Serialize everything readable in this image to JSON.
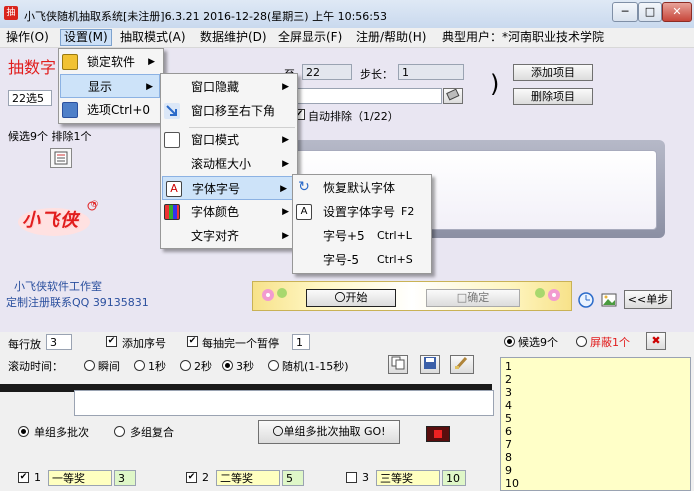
{
  "window": {
    "title": "小飞侠随机抽取系统[未注册]6.3.21 2016-12-28(星期三) 上午 10:56:53",
    "app_icon_label": "抽",
    "min_glyph": "─",
    "max_glyph": "□",
    "close_glyph": "✕"
  },
  "menubar": [
    "操作(O)",
    "设置(M)",
    "抽取模式(A)",
    "数据维护(D)",
    "全屏显示(F)",
    "注册/帮助(H)",
    "典型用户：*河南职业技术学院"
  ],
  "settings_menu": {
    "items": [
      {
        "label": "锁定软件",
        "icon": "lock-icon",
        "submenu": true
      },
      {
        "label": "显示",
        "icon": "",
        "submenu": true
      },
      {
        "label": "选项Ctrl+0",
        "icon": "options-icon",
        "submenu": false
      }
    ]
  },
  "display_menu": {
    "items": [
      {
        "label": "窗口隐藏",
        "submenu": true
      },
      {
        "label": "窗口移至右下角",
        "submenu": false
      },
      {
        "label": "窗口模式",
        "submenu": true
      },
      {
        "label": "滚动框大小",
        "submenu": true
      },
      {
        "label": "字体字号",
        "submenu": true
      },
      {
        "label": "字体颜色",
        "submenu": true
      },
      {
        "label": "文字对齐",
        "submenu": true
      }
    ]
  },
  "font_menu": {
    "items": [
      {
        "label": "恢复默认字体",
        "shortcut": ""
      },
      {
        "label": "设置字体字号",
        "shortcut": "F2"
      },
      {
        "label": "字号+5",
        "shortcut": "Ctrl+L"
      },
      {
        "label": "字号-5",
        "shortcut": "Ctrl+S"
      }
    ]
  },
  "main": {
    "mode_title": "抽数字",
    "range_to_label": "至",
    "range_to_value": "22",
    "step_label": "步长：",
    "step_value": "1",
    "mode_select_value": "22选5",
    "auto_exclude_label": "自动排除（1/22）",
    "add_item_label": "添加项目",
    "delete_item_label": "删除项目",
    "candidate_info": "候选9个 排除1个",
    "logo_text": "小飞侠",
    "logo_mark": "®",
    "studio_text": "小飞侠软件工作室",
    "contact_text": "定制注册联系QQ 39135831",
    "start_label": "〇开始",
    "confirm_label": "□确定",
    "single_step_label": "<<单步"
  },
  "controls": {
    "rows_per_line_label": "每行放",
    "rows_per_line_value": "3",
    "add_seq_label": "添加序号",
    "pause_label": "每抽完一个暂停",
    "pause_value": "1",
    "scroll_time_label": "滚动时间：",
    "speed_options": [
      "瞬间",
      "1秒",
      "2秒",
      "3秒",
      "随机(1-15秒)"
    ],
    "speed_selected": "3秒",
    "single_multi_label": "单组多批次",
    "multi_group_label": "多组复合",
    "batch_draw_label": "〇单组多批次抽取 GO!",
    "prize_rows": [
      {
        "index": "1",
        "name": "一等奖",
        "count": "3",
        "checked": true
      },
      {
        "index": "2",
        "name": "二等奖",
        "count": "5",
        "checked": true
      },
      {
        "index": "3",
        "name": "三等奖",
        "count": "10",
        "checked": false
      }
    ]
  },
  "list_panel": {
    "candidates_label": "候选9个",
    "hidden_label": "屏蔽1个",
    "items": [
      "1",
      "2",
      "3",
      "4",
      "5",
      "6",
      "7",
      "8",
      "9",
      "10"
    ]
  },
  "colors": {
    "accent_red": "#e11d1d",
    "link_blue": "#2a4f9e",
    "list_bg": "#ffffc8",
    "menu_highlight": "#cde3f9"
  }
}
